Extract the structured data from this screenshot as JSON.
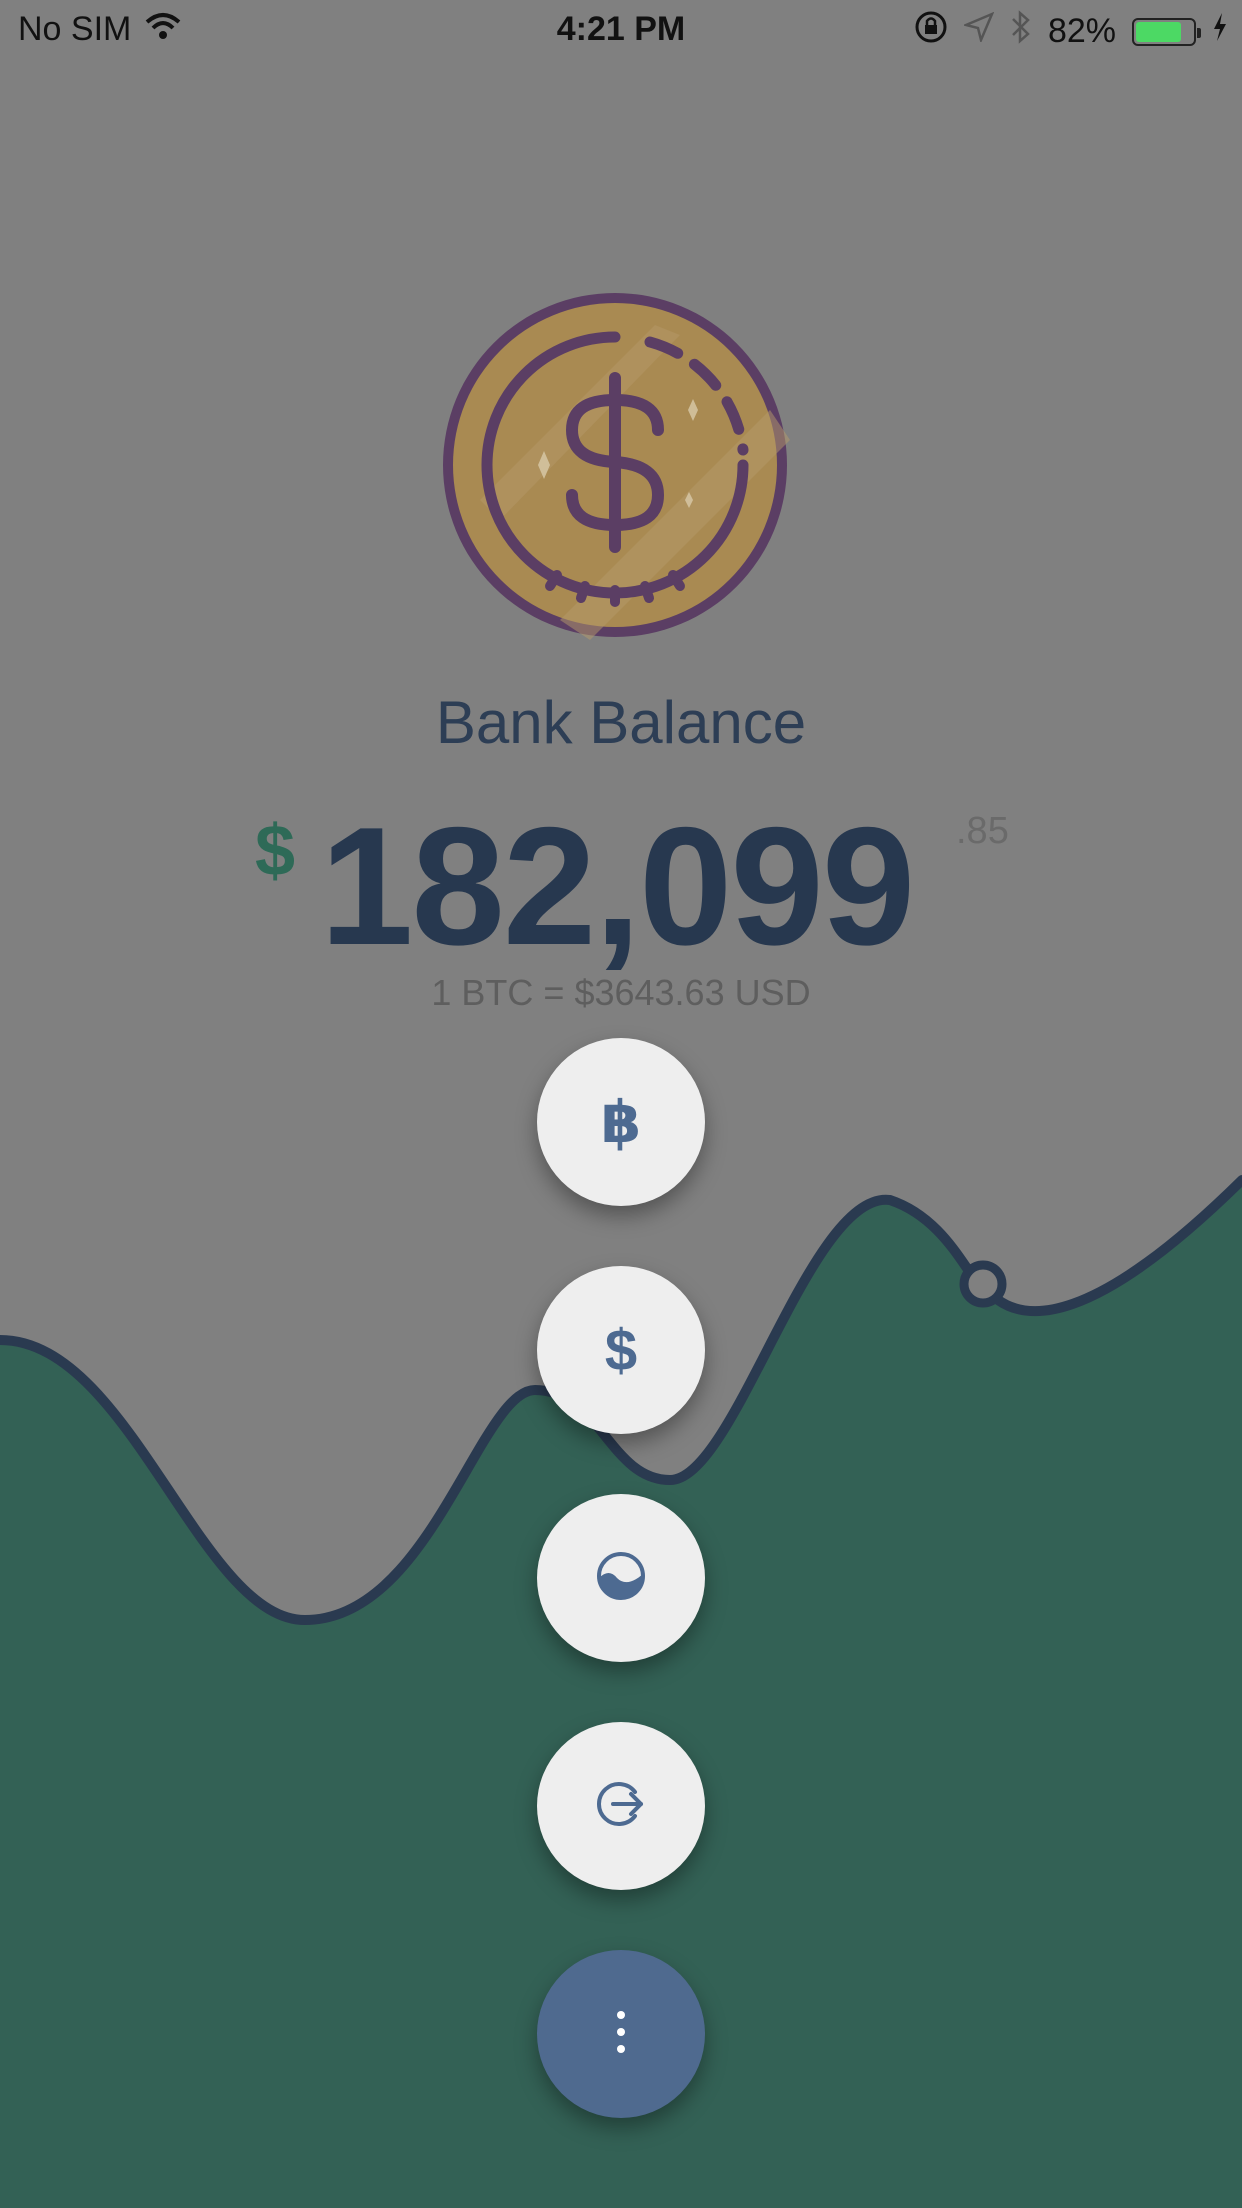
{
  "status_bar": {
    "carrier": "No SIM",
    "time": "4:21 PM",
    "battery": "82%",
    "battery_level": 0.82
  },
  "balance_card": {
    "title": "Bank Balance",
    "currency_symbol": "$",
    "amount_whole": "182,099",
    "amount_cents": ".85",
    "rate": "1 BTC = $3643.63 USD"
  },
  "chart": {
    "area_color": "#336155",
    "line_color": "#2a3a50"
  },
  "actions": [
    {
      "name": "bitcoin-action",
      "glyph": "฿"
    },
    {
      "name": "dollar-action",
      "glyph": "$"
    },
    {
      "name": "chart-action",
      "glyph": ""
    },
    {
      "name": "logout-action",
      "glyph": ""
    }
  ],
  "menu_fab": {
    "glyph": "⋮"
  }
}
